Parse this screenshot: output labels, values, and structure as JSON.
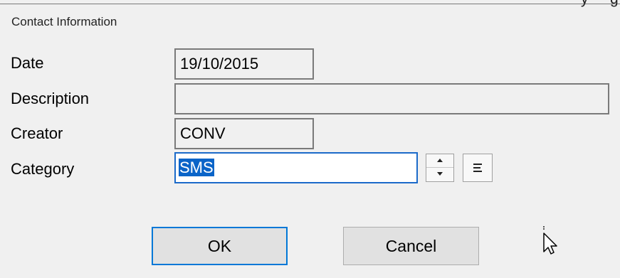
{
  "window": {
    "title_fragment": "y",
    "title_fragment_right": "g"
  },
  "section": {
    "caption": "Contact Information"
  },
  "form": {
    "date_label": "Date",
    "date_value": "19/10/2015",
    "description_label": "Description",
    "description_value": "",
    "creator_label": "Creator",
    "creator_value": "CONV",
    "category_label": "Category",
    "category_value": "SMS"
  },
  "buttons": {
    "ok_label": "OK",
    "cancel_label": "Cancel"
  },
  "icons": {
    "spinner": "spinner-icon",
    "list": "list-icon",
    "cursor": "mouse-pointer-icon"
  }
}
